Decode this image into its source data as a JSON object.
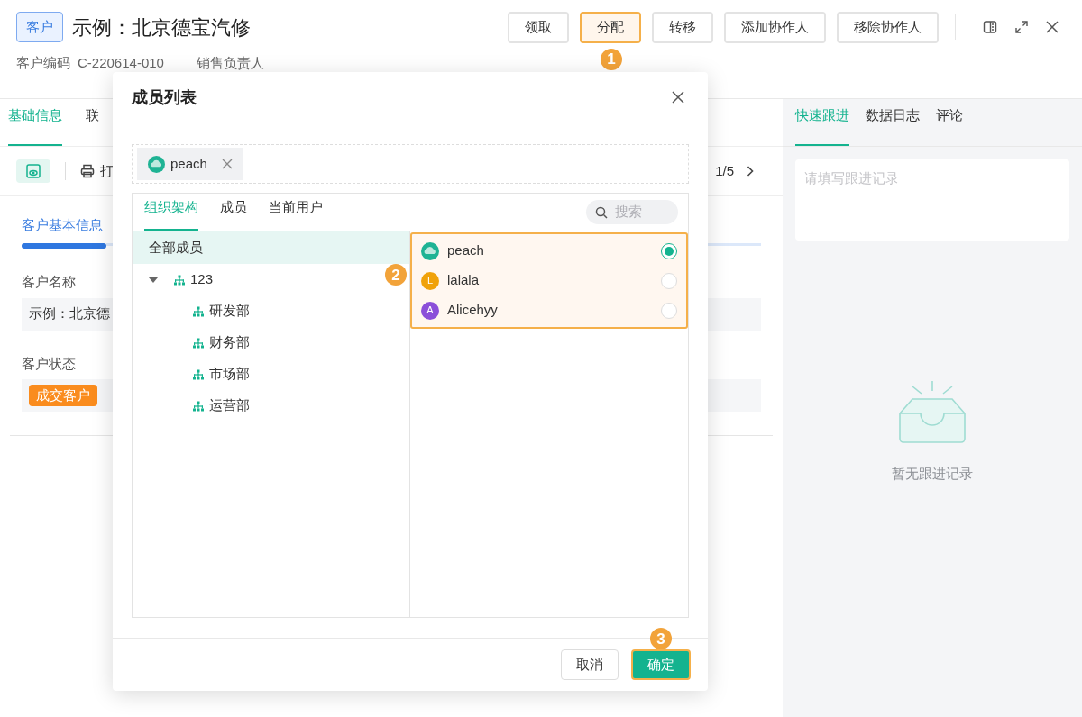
{
  "header": {
    "tag": "客户",
    "title": "示例：北京德宝汽修",
    "actions": [
      {
        "label": "领取",
        "selected": false
      },
      {
        "label": "分配",
        "selected": true
      },
      {
        "label": "转移",
        "selected": false
      },
      {
        "label": "添加协作人",
        "selected": false
      },
      {
        "label": "移除协作人",
        "selected": false
      }
    ],
    "step_badge": "1",
    "code_label": "客户编码",
    "code_value": "C-220614-010",
    "owner_label": "销售负责人"
  },
  "detail": {
    "tabs": [
      {
        "label": "基础信息",
        "selected": true
      },
      {
        "label": "联",
        "selected": false
      }
    ],
    "print_label": "打",
    "pager": "1/5",
    "section_title": "客户基本信息",
    "fields": [
      {
        "kind": "text",
        "label": "客户名称",
        "value": "示例：北京德"
      },
      {
        "kind": "tag",
        "label": "客户状态",
        "value": "成交客户"
      }
    ]
  },
  "side_panel": {
    "tabs": [
      {
        "label": "快速跟进",
        "selected": true
      },
      {
        "label": "数据日志",
        "selected": false
      },
      {
        "label": "评论",
        "selected": false
      }
    ],
    "placeholder": "请填写跟进记录",
    "empty_text": "暂无跟进记录"
  },
  "modal": {
    "title": "成员列表",
    "chosen": [
      {
        "name": "peach"
      }
    ],
    "tabs": [
      {
        "label": "组织架构",
        "selected": true
      },
      {
        "label": "成员",
        "selected": false
      },
      {
        "label": "当前用户",
        "selected": false
      }
    ],
    "search_placeholder": "搜索",
    "all_item": {
      "label": "全部成员",
      "selected": true
    },
    "tree": [
      {
        "label": "123",
        "expanded": true,
        "selected": false,
        "children": [
          {
            "label": "研发部",
            "selected": false
          },
          {
            "label": "财务部",
            "selected": false
          },
          {
            "label": "市场部",
            "selected": false
          },
          {
            "label": "运营部",
            "selected": false
          }
        ]
      }
    ],
    "members_step_badge": "2",
    "members": [
      {
        "name": "peach",
        "kind": "picture",
        "selected": true
      },
      {
        "name": "lalala",
        "kind": "letter",
        "initial": "L",
        "color": "#f0a20a",
        "selected": false
      },
      {
        "name": "Alicehyy",
        "kind": "letter",
        "initial": "A",
        "color": "#8b4fd9",
        "selected": false
      }
    ],
    "cancel": "取消",
    "confirm": "确定",
    "confirm_step_badge": "3"
  }
}
